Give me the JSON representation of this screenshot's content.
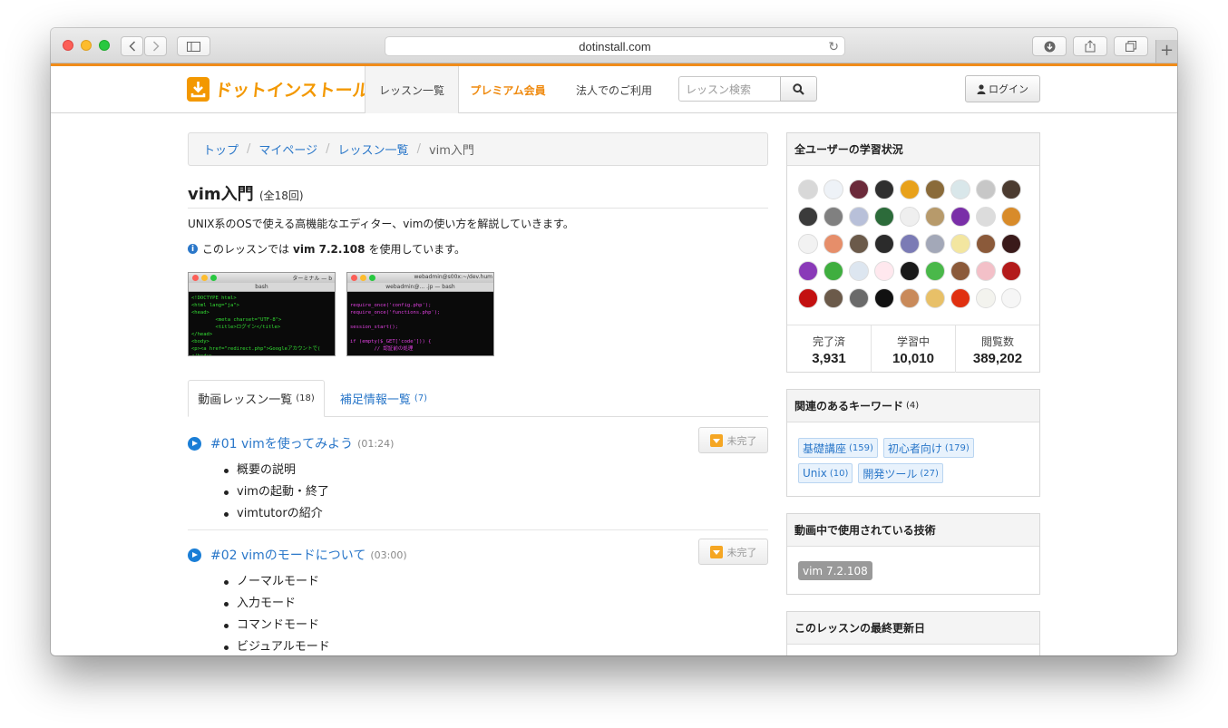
{
  "browser": {
    "url": "dotinstall.com"
  },
  "header": {
    "logo_text": "ドットインストール",
    "nav": [
      "レッスン一覧",
      "プレミアム会員",
      "法人でのご利用"
    ],
    "search_placeholder": "レッスン検索",
    "login_label": "ログイン"
  },
  "breadcrumb": [
    "トップ",
    "マイページ",
    "レッスン一覧",
    "vim入門"
  ],
  "course": {
    "title": "vim入門",
    "count": "(全18回)",
    "description": "UNIX系のOSで使える高機能なエディター、vimの使い方を解説していきます。",
    "info_prefix": "このレッスンでは",
    "info_version": "vim 7.2.108",
    "info_suffix": "を使用しています。"
  },
  "screenshots": [
    {
      "window_title": "ターミナル — b",
      "tab": "bash",
      "code_lines": [
        "<!DOCTYPE html>",
        "<html lang=\"ja\">",
        "<head>",
        "        <meta charset=\"UTF-8\">",
        "        <title>ログイン</title>",
        "</head>",
        "<body>",
        "<p><a href=\"redirect.php\">Googleアカウントで(",
        "</body>"
      ]
    },
    {
      "window_title": "webadmin@s00x:~/dev.hum",
      "tab": "webadmin@... .jp — bash",
      "code_lines": [
        "",
        "require_once('config.php');",
        "require_once('functions.php');",
        "",
        "session_start();",
        "",
        "if (empty($_GET['code'])) {",
        "        // 認証前の処理"
      ]
    }
  ],
  "tabs": [
    {
      "label": "動画レッスン一覧",
      "count": "(18)"
    },
    {
      "label": "補足情報一覧",
      "count": "(7)"
    }
  ],
  "lessons": [
    {
      "title": "#01 vimを使ってみよう",
      "duration": "(01:24)",
      "status": "未完了",
      "items": [
        "概要の説明",
        "vimの起動・終了",
        "vimtutorの紹介"
      ]
    },
    {
      "title": "#02 vimのモードについて",
      "duration": "(03:00)",
      "status": "未完了",
      "items": [
        "ノーマルモード",
        "入力モード",
        "コマンドモード",
        "ビジュアルモード"
      ]
    }
  ],
  "sidebar": {
    "status": {
      "title": "全ユーザーの学習状況",
      "stats": [
        {
          "label": "完了済",
          "value": "3,931"
        },
        {
          "label": "学習中",
          "value": "10,010"
        },
        {
          "label": "閲覧数",
          "value": "389,202"
        }
      ]
    },
    "keywords": {
      "title": "関連のあるキーワード",
      "count": "(4)",
      "items": [
        {
          "label": "基礎講座",
          "count": "(159)"
        },
        {
          "label": "初心者向け",
          "count": "(179)"
        },
        {
          "label": "Unix",
          "count": "(10)"
        },
        {
          "label": "開発ツール",
          "count": "(27)"
        }
      ]
    },
    "tech": {
      "title": "動画中で使用されている技術",
      "item": "vim 7.2.108"
    },
    "updated": {
      "title": "このレッスンの最終更新日"
    }
  },
  "colors": {
    "accent": "#f08c1a",
    "link": "#2a77c9"
  },
  "avatar_colors": [
    "#d8d8d8",
    "#eef2f7",
    "#6b2a3a",
    "#2f2f2f",
    "#e8a11a",
    "#8a6b3a",
    "#d9e7ea",
    "#c7c7c7",
    "#4b3b30",
    "#3b3b3b",
    "#808080",
    "#b8c0d9",
    "#2c6b3a",
    "#efefef",
    "#b79a6b",
    "#7a2fa8",
    "#dcdcdc",
    "#d88b2a",
    "#f2f2f2",
    "#e68e6a",
    "#6b5a4a",
    "#2b2b2b",
    "#7b7bb5",
    "#a3a8b8",
    "#f3e6a0",
    "#8b5a3a",
    "#3a1a1a",
    "#8a3ab8",
    "#3fae3f",
    "#dde6f0",
    "#ffe8ee",
    "#1a1a1a",
    "#4ab84a",
    "#8b5a3a",
    "#f3c0c8",
    "#b31b1b",
    "#c31010",
    "#6b5a4a",
    "#6a6a6a",
    "#111111",
    "#c98a5a",
    "#e8c068",
    "#e03010",
    "#f3f3ee",
    "#f6f6f6"
  ]
}
